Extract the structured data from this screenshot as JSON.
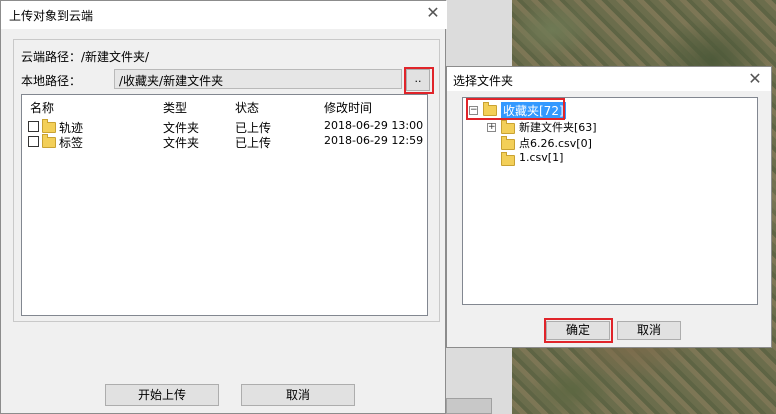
{
  "main_dialog": {
    "title": "上传对象到云端",
    "cloud_path_label": "云端路径：/新建文件夹/",
    "local_path_label": "本地路径：",
    "local_path_value": "/收藏夹/新建文件夹",
    "browse_label": "..",
    "columns": [
      "名称",
      "类型",
      "状态",
      "修改时间"
    ],
    "rows": [
      {
        "name": "轨迹",
        "type": "文件夹",
        "status": "已上传",
        "modified": "2018-06-29 13:00"
      },
      {
        "name": "标签",
        "type": "文件夹",
        "status": "已上传",
        "modified": "2018-06-29 12:59"
      }
    ],
    "start_upload_label": "开始上传",
    "cancel_label": "取消"
  },
  "folder_dialog": {
    "title": "选择文件夹",
    "tree": {
      "root": "收藏夹[72]",
      "children": [
        "新建文件夹[63]",
        "点6.26.csv[0]",
        "1.csv[1]"
      ]
    },
    "ok_label": "确定",
    "cancel_label": "取消"
  },
  "icons": {
    "close": "close-icon",
    "folder": "folder-icon",
    "expand": "expand-icon",
    "collapse": "collapse-icon"
  },
  "colors": {
    "highlight_red": "#e0242a",
    "selection_blue": "#3399ff",
    "folder_yellow": "#f3cf58"
  }
}
